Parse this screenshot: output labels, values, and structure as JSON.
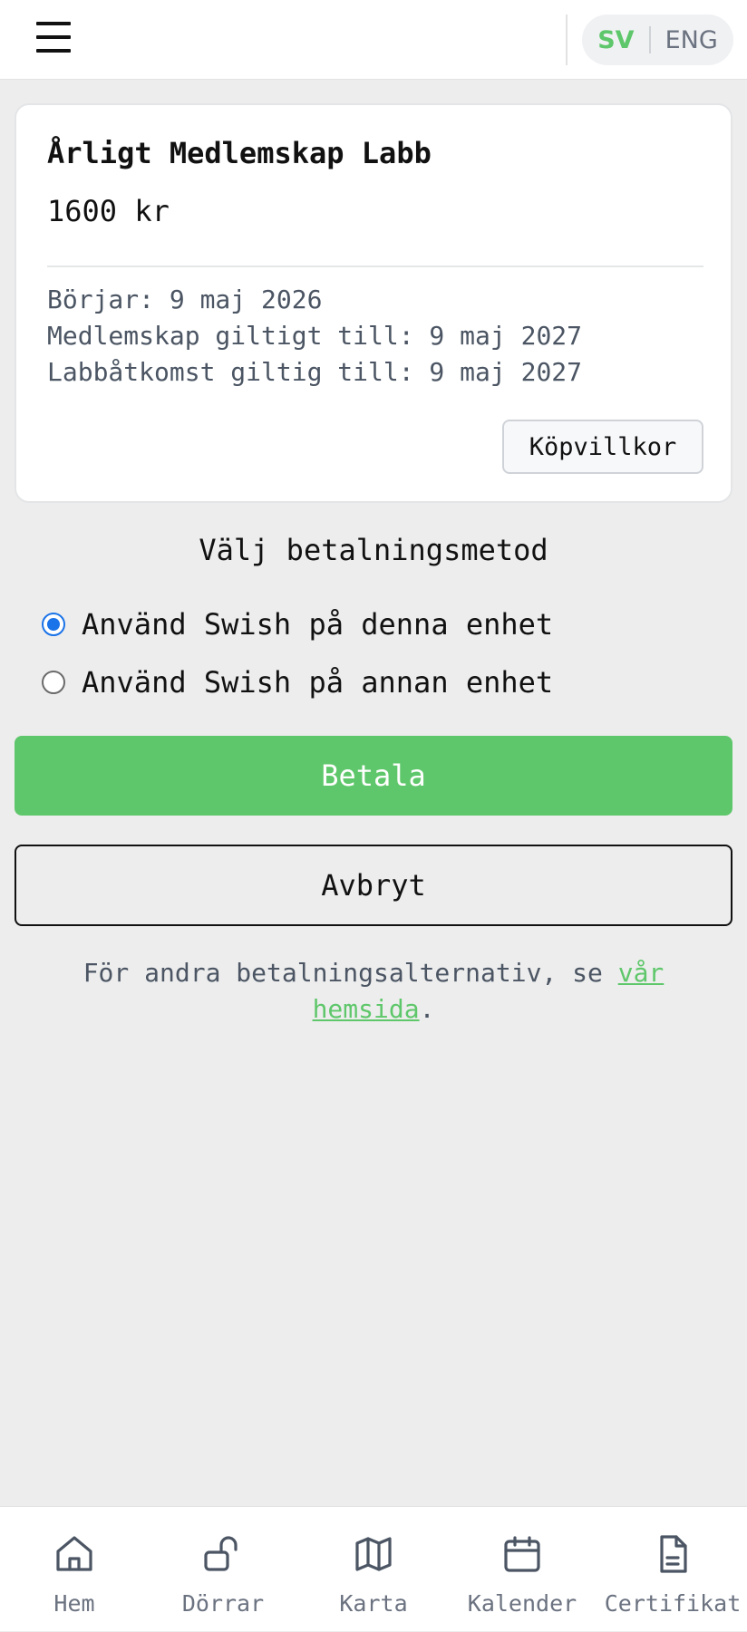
{
  "header": {
    "menu_icon": "hamburger-menu-icon",
    "lang_sv": "SV",
    "lang_eng": "ENG",
    "active_lang": "SV",
    "accent_color": "#5fc76b"
  },
  "product": {
    "title": "Årligt Medlemskap Labb",
    "price": "1600 kr",
    "starts": "Börjar: 9 maj 2026",
    "membership_valid": "Medlemskap giltigt till: 9 maj 2027",
    "lab_access_valid": "Labbåtkomst giltig till: 9 maj 2027",
    "terms_button": "Köpvillkor"
  },
  "payment": {
    "heading": "Välj betalningsmetod",
    "options": [
      {
        "label": "Använd Swish på denna enhet",
        "selected": true
      },
      {
        "label": "Använd Swish på annan enhet",
        "selected": false
      }
    ],
    "pay_button": "Betala",
    "cancel_button": "Avbryt",
    "footnote_prefix": "För andra betalningsalternativ, se ",
    "footnote_link": "vår hemsida",
    "footnote_suffix": "."
  },
  "bottom_nav": {
    "items": [
      {
        "label": "Hem",
        "icon": "home-icon"
      },
      {
        "label": "Dörrar",
        "icon": "unlocked-padlock-icon"
      },
      {
        "label": "Karta",
        "icon": "map-icon"
      },
      {
        "label": "Kalender",
        "icon": "calendar-icon"
      },
      {
        "label": "Certifikat",
        "icon": "document-icon"
      }
    ]
  }
}
